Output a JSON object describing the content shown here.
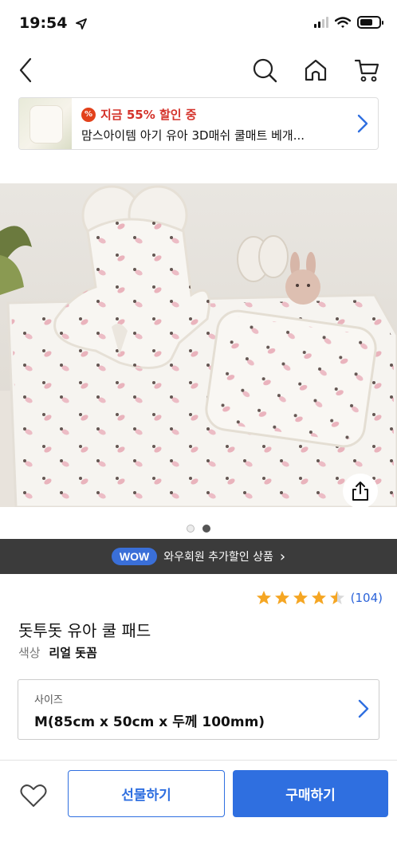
{
  "status_bar": {
    "time": "19:54",
    "location_icon": "location-arrow-icon",
    "signal_bars_active": 2,
    "battery_level": 0.7
  },
  "nav": {
    "back_icon": "chevron-left-icon",
    "search_icon": "search-icon",
    "home_icon": "home-icon",
    "cart_icon": "cart-icon"
  },
  "promo_banner": {
    "badge_icon": "percent-badge-icon",
    "badge_symbol": "%",
    "badge_text": "지금 55% 할인 중",
    "title": "맘스아이템 아기 유아 3D매쉬 쿨매트 베개...",
    "chevron_icon": "chevron-right-icon"
  },
  "gallery": {
    "image_count": 2,
    "active_index": 1,
    "share_icon": "share-icon"
  },
  "wow_bar": {
    "pill": "WOW",
    "text": "와우회원 추가할인 상품",
    "chevron": "›"
  },
  "rating": {
    "stars": 4.5,
    "count": "(104)"
  },
  "product": {
    "title": "돗투돗 유아 쿨 패드",
    "color_label": "색상",
    "color_value": "리얼 돗꼼"
  },
  "size_selector": {
    "label": "사이즈",
    "value": "M(85cm x 50cm x 두께 100mm)"
  },
  "bottom_bar": {
    "favorite_icon": "heart-icon",
    "gift_label": "선물하기",
    "buy_label": "구매하기"
  },
  "colors": {
    "accent_blue": "#2f6fe0",
    "sale_red": "#d4322a",
    "star_gold": "#f5a623",
    "wow_bar_bg": "#3b3b3b"
  }
}
